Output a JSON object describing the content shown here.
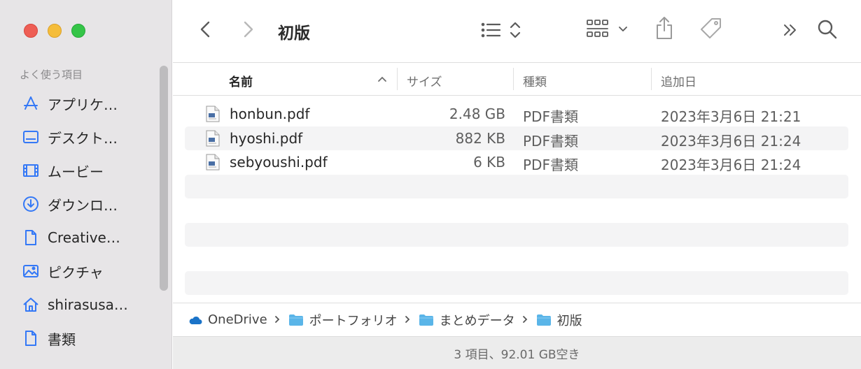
{
  "window": {
    "title": "初版"
  },
  "sidebar": {
    "section_title": "よく使う項目",
    "items": [
      {
        "label": "アプリケ…",
        "icon": "applications-icon"
      },
      {
        "label": "デスクト…",
        "icon": "desktop-icon"
      },
      {
        "label": "ムービー",
        "icon": "movies-icon"
      },
      {
        "label": "ダウンロ…",
        "icon": "downloads-icon"
      },
      {
        "label": "Creative…",
        "icon": "document-icon"
      },
      {
        "label": "ピクチャ",
        "icon": "pictures-icon"
      },
      {
        "label": "shirasusa…",
        "icon": "home-icon"
      },
      {
        "label": "書類",
        "icon": "documents-icon"
      }
    ]
  },
  "columns": {
    "name": "名前",
    "size": "サイズ",
    "kind": "種類",
    "date_added": "追加日"
  },
  "files": [
    {
      "name": "honbun.pdf",
      "size": "2.48 GB",
      "kind": "PDF書類",
      "date": "2023年3月6日 21:21"
    },
    {
      "name": "hyoshi.pdf",
      "size": "882 KB",
      "kind": "PDF書類",
      "date": "2023年3月6日 21:24"
    },
    {
      "name": "sebyoushi.pdf",
      "size": "6 KB",
      "kind": "PDF書類",
      "date": "2023年3月6日 21:24"
    }
  ],
  "path": [
    {
      "label": "OneDrive",
      "icon": "onedrive-icon"
    },
    {
      "label": "ポートフォリオ",
      "icon": "folder-icon"
    },
    {
      "label": "まとめデータ",
      "icon": "folder-icon"
    },
    {
      "label": "初版",
      "icon": "folder-icon"
    }
  ],
  "status": {
    "text": "3 項目、92.01 GB空き"
  },
  "colors": {
    "folder": "#5ab5e8",
    "onedrive": "#1a73c8",
    "accent": "#3478f6"
  }
}
